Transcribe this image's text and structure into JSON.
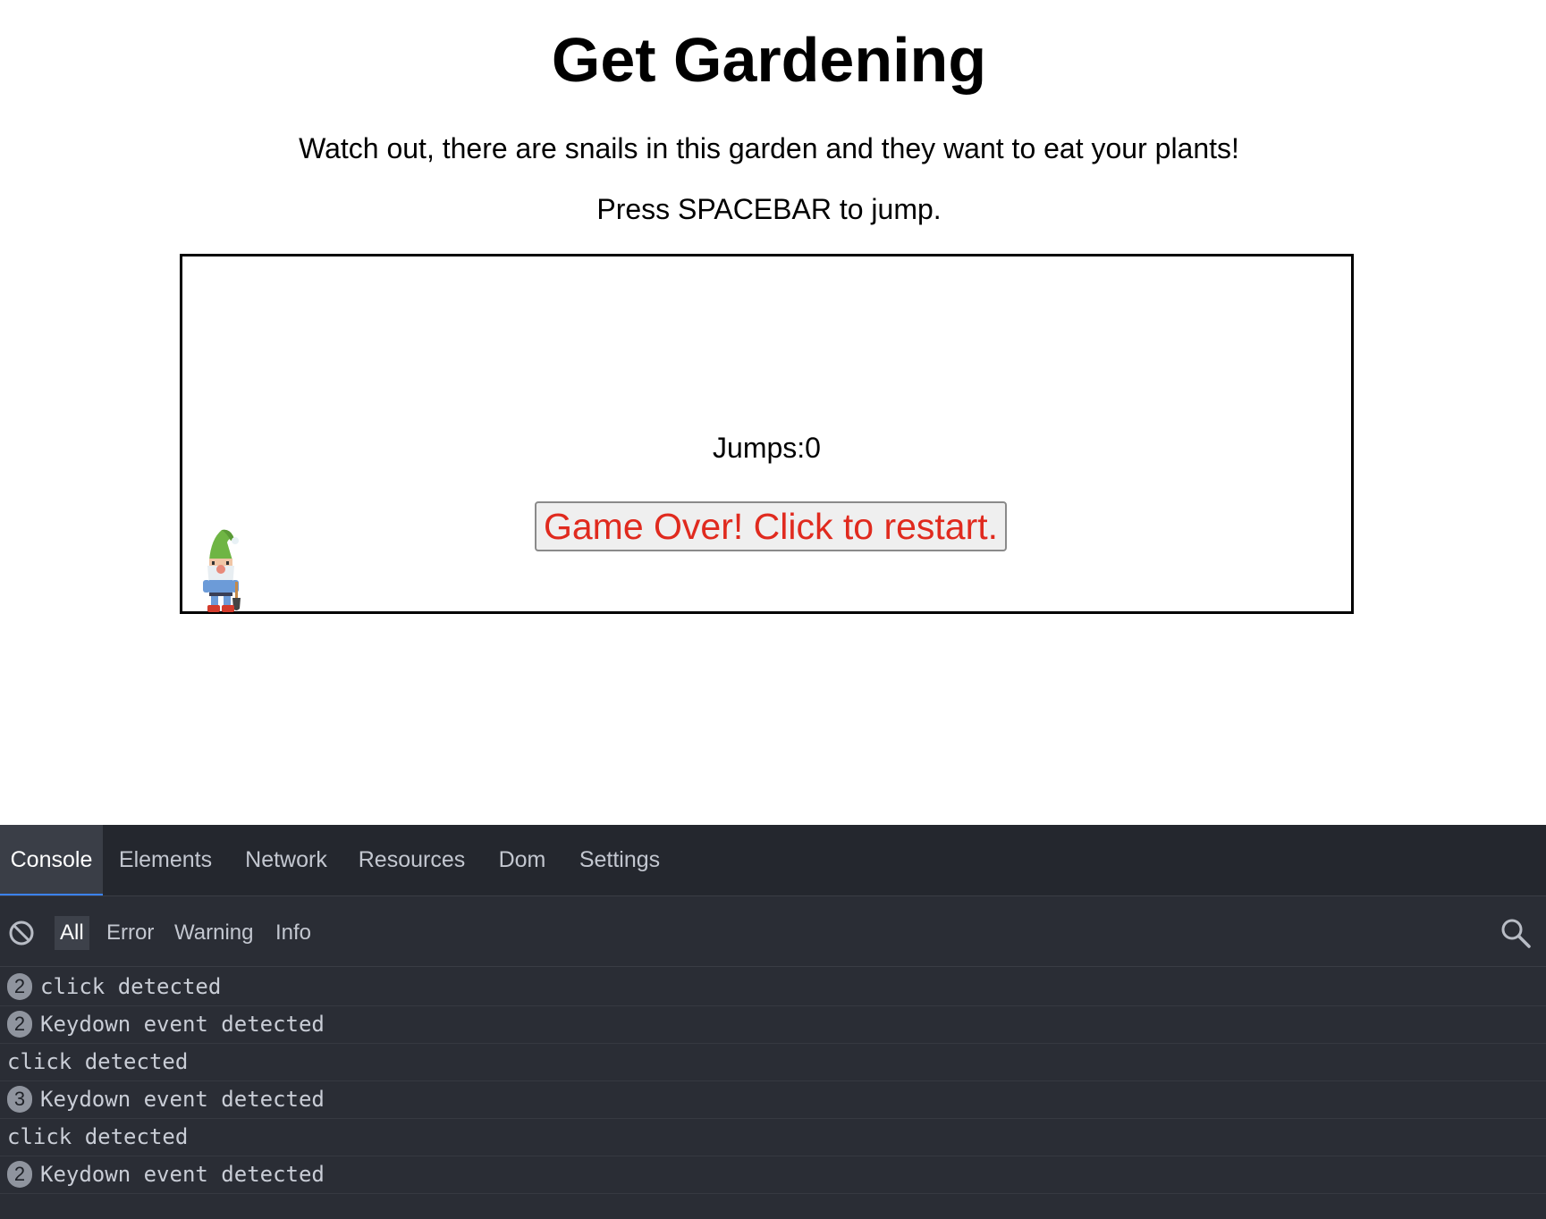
{
  "page": {
    "title": "Get Gardening",
    "intro": "Watch out, there are snails in this garden and they want to eat your plants!",
    "instructions": "Press SPACEBAR to jump."
  },
  "game": {
    "jumps_text": "Jumps:0",
    "restart_label": "Game Over! Click to restart.",
    "character": "gnome"
  },
  "devtools": {
    "tabs": [
      {
        "label": "Console",
        "active": true
      },
      {
        "label": "Elements",
        "active": false
      },
      {
        "label": "Network",
        "active": false
      },
      {
        "label": "Resources",
        "active": false
      },
      {
        "label": "Dom",
        "active": false
      },
      {
        "label": "Settings",
        "active": false
      }
    ],
    "filters": [
      {
        "label": "All",
        "active": true
      },
      {
        "label": "Error",
        "active": false
      },
      {
        "label": "Warning",
        "active": false
      },
      {
        "label": "Info",
        "active": false
      }
    ],
    "icons": {
      "clear": "clear-console-icon",
      "search": "search-icon"
    },
    "logs": [
      {
        "count": "2",
        "message": "click detected"
      },
      {
        "count": "2",
        "message": "Keydown event detected"
      },
      {
        "count": "",
        "message": "click detected"
      },
      {
        "count": "3",
        "message": "Keydown event detected"
      },
      {
        "count": "",
        "message": "click detected"
      },
      {
        "count": "2",
        "message": "Keydown event detected"
      }
    ]
  },
  "colors": {
    "restart_text": "#e02a1e",
    "devtools_bg": "#2a2d35",
    "active_tab_underline": "#3b82f6"
  }
}
